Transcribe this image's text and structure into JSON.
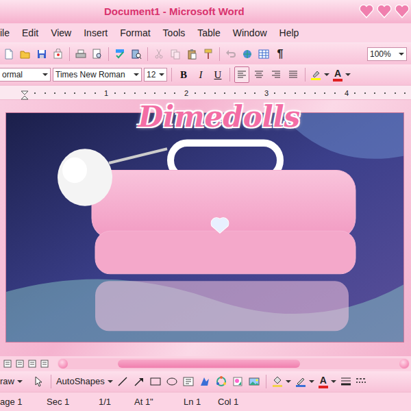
{
  "window": {
    "title": "Document1 - Microsoft Word"
  },
  "menu": [
    "ile",
    "Edit",
    "View",
    "Insert",
    "Format",
    "Tools",
    "Table",
    "Window",
    "Help"
  ],
  "standard_toolbar": {
    "buttons": [
      {
        "kind": "new",
        "disabled": false
      },
      {
        "kind": "open",
        "disabled": false
      },
      {
        "kind": "save",
        "disabled": false
      },
      {
        "kind": "permission",
        "disabled": false
      },
      {
        "kind": "print",
        "disabled": false
      },
      {
        "kind": "preview",
        "disabled": false
      },
      {
        "kind": "spelling",
        "disabled": false
      },
      {
        "kind": "research",
        "disabled": false
      },
      {
        "kind": "cut",
        "disabled": true
      },
      {
        "kind": "copy",
        "disabled": true
      },
      {
        "kind": "paste",
        "disabled": false
      },
      {
        "kind": "painter",
        "disabled": false
      },
      {
        "kind": "undo",
        "disabled": true
      },
      {
        "kind": "hyperlink",
        "disabled": false
      },
      {
        "kind": "tables",
        "disabled": false
      }
    ],
    "show_hide": "¶",
    "zoom": "100%"
  },
  "formatting_toolbar": {
    "style": "ormal",
    "font": "Times New Roman",
    "size": "12",
    "bold": "B",
    "italic": "I",
    "underline": "U",
    "alignment": [
      {
        "kind": "left",
        "selected": true
      },
      {
        "kind": "center",
        "selected": false
      },
      {
        "kind": "right",
        "selected": false
      },
      {
        "kind": "justify",
        "selected": false
      }
    ],
    "font_color": "A"
  },
  "ruler": {
    "ticks": [
      "1",
      "2",
      "3",
      "4"
    ]
  },
  "document": {
    "heading": "Dimedolls"
  },
  "drawing_toolbar": {
    "draw": "raw",
    "autoshapes": "AutoShapes",
    "tools": [
      {
        "kind": "line"
      },
      {
        "kind": "arrow"
      },
      {
        "kind": "rectangle"
      },
      {
        "kind": "oval"
      },
      {
        "kind": "textbox"
      },
      {
        "kind": "wordart"
      },
      {
        "kind": "diagram"
      },
      {
        "kind": "clipart"
      },
      {
        "kind": "picture"
      }
    ],
    "font_color": "A"
  },
  "status_bar": [
    "age 1",
    "Sec 1",
    "1/1",
    "At 1\"",
    "Ln 1",
    "Col 1"
  ]
}
